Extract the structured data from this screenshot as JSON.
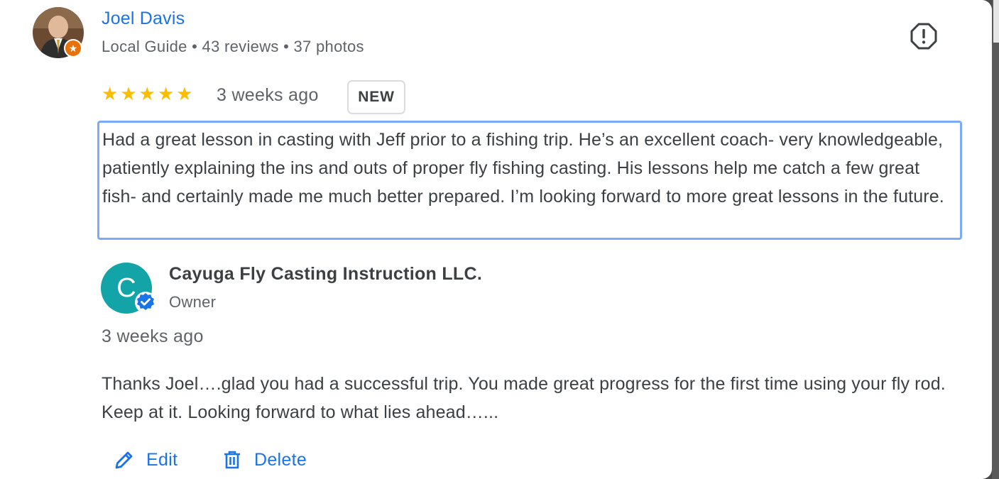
{
  "reviewer": {
    "name": "Joel Davis",
    "meta": "Local Guide • 43 reviews • 37 photos",
    "badge_icon": "star-icon"
  },
  "review": {
    "rating": 5,
    "max_rating": 5,
    "date": "3 weeks ago",
    "badge": "NEW",
    "text": "Had a great lesson in casting with Jeff prior to a fishing trip. He’s an excellent coach- very knowledgeable, patiently explaining the ins and outs of proper fly fishing casting. His lessons help me catch a few great fish- and certainly made me much better prepared. I’m looking forward to more great lessons in the future."
  },
  "owner_reply": {
    "avatar_letter": "C",
    "name": "Cayuga Fly Casting Instruction LLC.",
    "role": "Owner",
    "date": "3 weeks ago",
    "text": "Thanks Joel….glad you had a successful trip. You made great progress for the first time using your fly rod. Keep at it. Looking forward to what lies ahead…..."
  },
  "actions": {
    "edit_label": "Edit",
    "delete_label": "Delete"
  },
  "colors": {
    "link_blue": "#1a73e8",
    "star_yellow": "#fbbc04",
    "owner_avatar": "#12a4a7",
    "guide_badge": "#e8710a",
    "focus_border": "#7baaf7"
  }
}
